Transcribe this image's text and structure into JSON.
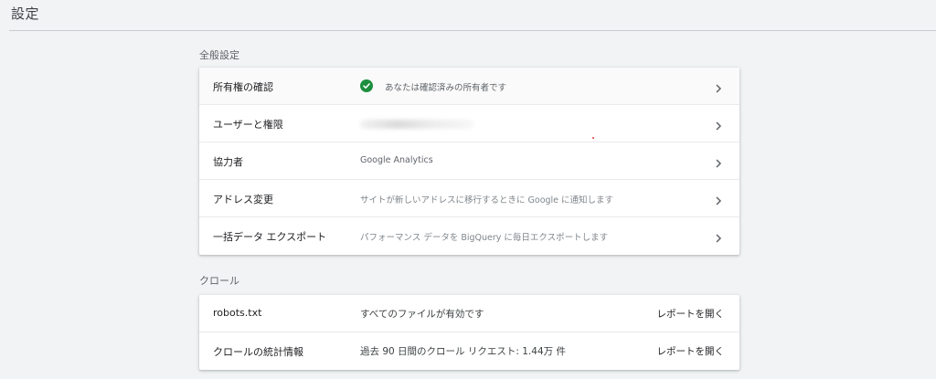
{
  "header": {
    "title": "設定"
  },
  "general": {
    "section_title": "全般設定",
    "rows": [
      {
        "label": "所有権の確認",
        "value": "あなたは確認済みの所有者です",
        "icon": "check-circle-icon"
      },
      {
        "label": "ユーザーと権限",
        "value": ""
      },
      {
        "label": "協力者",
        "value": "Google Analytics"
      },
      {
        "label": "アドレス変更",
        "value": "サイトが新しいアドレスに移行するときに Google に通知します"
      },
      {
        "label": "一括データ エクスポート",
        "value": "パフォーマンス データを BigQuery に毎日エクスポートします"
      }
    ]
  },
  "crawl": {
    "section_title": "クロール",
    "rows": [
      {
        "label": "robots.txt",
        "value": "すべてのファイルが有効です",
        "action": "レポートを開く"
      },
      {
        "label": "クロールの統計情報",
        "value": "過去 90 日間のクロール リクエスト: 1.44万 件",
        "action": "レポートを開く"
      }
    ]
  },
  "colors": {
    "verified_green": "#1e8e3e",
    "background": "#f1f3f4"
  }
}
